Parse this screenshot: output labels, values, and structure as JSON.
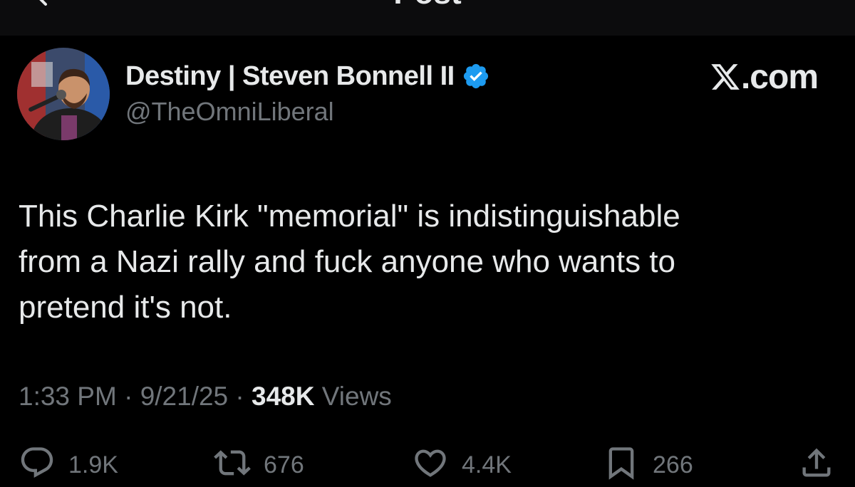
{
  "header": {
    "title": "Post"
  },
  "author": {
    "display_name": "Destiny | Steven Bonnell II",
    "handle": "@TheOmniLiberal",
    "verified_color": "#1d9bf0"
  },
  "watermark": {
    "text": ".com",
    "icon": "x-logo-icon"
  },
  "post": {
    "text": "This Charlie Kirk \"memorial\" is indistinguishable\nfrom a Nazi rally and fuck anyone who wants to\npretend it's not."
  },
  "meta": {
    "time": "1:33 PM",
    "separator": " · ",
    "date": "9/21/25",
    "views_count": "348K",
    "views_label": " Views"
  },
  "actions": {
    "replies": "1.9K",
    "reposts": "676",
    "likes": "4.4K",
    "bookmarks": "266"
  },
  "colors": {
    "background": "#000000",
    "text_primary": "#e7e9ea",
    "text_secondary": "#71767b",
    "accent": "#1d9bf0"
  }
}
